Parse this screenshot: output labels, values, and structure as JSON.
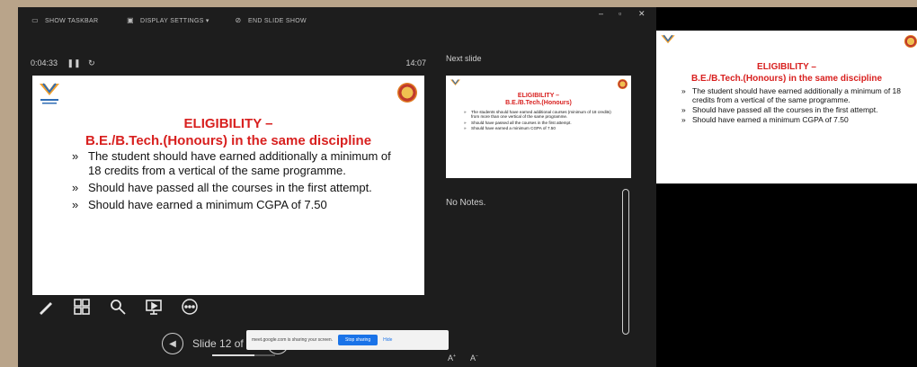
{
  "toolbar": {
    "show_taskbar": "SHOW TASKBAR",
    "display_settings": "DISPLAY SETTINGS ▾",
    "end_slide_show": "END SLIDE SHOW",
    "minimize": "–",
    "maximize": "▫",
    "close": "✕"
  },
  "timer": {
    "elapsed": "0:04:33",
    "pause_icon": "❚❚",
    "reset_icon": "↻",
    "clock": "14:07"
  },
  "slide": {
    "title_line1": "ELIGIBILITY –",
    "title_line2": "B.E./B.Tech.(Honours) in the same discipline",
    "bullets": [
      "The student should have earned additionally a minimum of 18 credits from a vertical of the same programme.",
      "Should have passed all the courses in the first attempt.",
      "Should have earned a minimum CGPA of 7.50"
    ]
  },
  "tools": [
    "pen-icon",
    "slides-grid-icon",
    "zoom-icon",
    "pointer-screen-icon",
    "more-icon"
  ],
  "navigation": {
    "slide_counter": "Slide 12 of 18",
    "progress": 0.6667
  },
  "share_bar": {
    "message": "meet.google.com is sharing your screen.",
    "stop_label": "Stop sharing",
    "hide_label": "Hide"
  },
  "next_slide": {
    "label": "Next slide",
    "title_line1": "ELIGIBILITY –",
    "title_line2": "B.E./B.Tech.(Honours)",
    "bullets": [
      "The students should have earned additional courses (minimum of 18 credits) from more than one vertical of the same programme.",
      "Should have passed all the courses in the first attempt.",
      "Should have earned a minimum CGPA of 7.50"
    ]
  },
  "notes": {
    "text": "No Notes."
  },
  "font_controls": {
    "increase": "A",
    "decrease": "A"
  },
  "audience_slide": {
    "title_line1": "ELIGIBILITY –",
    "title_line2": "B.E./B.Tech.(Honours) in the same discipline",
    "bullets": [
      "The student should have earned additionally a minimum of 18 credits from a vertical of the same programme.",
      "Should have passed all the courses in the first attempt.",
      "Should have earned a minimum CGPA of 7.50"
    ]
  },
  "colors": {
    "accent_red": "#d8201f",
    "presenter_bg": "#1d1d1d",
    "share_blue": "#1a73e8"
  }
}
